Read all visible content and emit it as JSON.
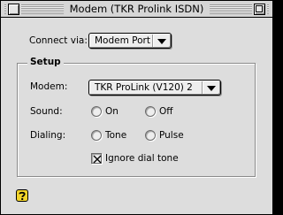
{
  "window": {
    "title": "Modem (TKR Prolink ISDN)"
  },
  "connect": {
    "label": "Connect via:",
    "value": "Modem Port"
  },
  "setup": {
    "title": "Setup",
    "modem": {
      "label": "Modem:",
      "value": "TKR ProLink (V120) 2"
    },
    "sound": {
      "label": "Sound:",
      "options": [
        "On",
        "Off"
      ],
      "selected": null
    },
    "dialing": {
      "label": "Dialing:",
      "options": [
        "Tone",
        "Pulse"
      ],
      "selected": null
    },
    "ignore_dial_tone": {
      "label": "Ignore dial tone",
      "checked": true
    }
  },
  "icons": {
    "close": "close-box-icon",
    "zoom": "zoom-box-icon",
    "popup": "chevron-down-icon",
    "help": "question-mark-help-icon"
  },
  "colors": {
    "window_background": "#dddddd",
    "title_stripes": "#9a9a9a",
    "help_icon_yellow": "#f2d42a"
  }
}
